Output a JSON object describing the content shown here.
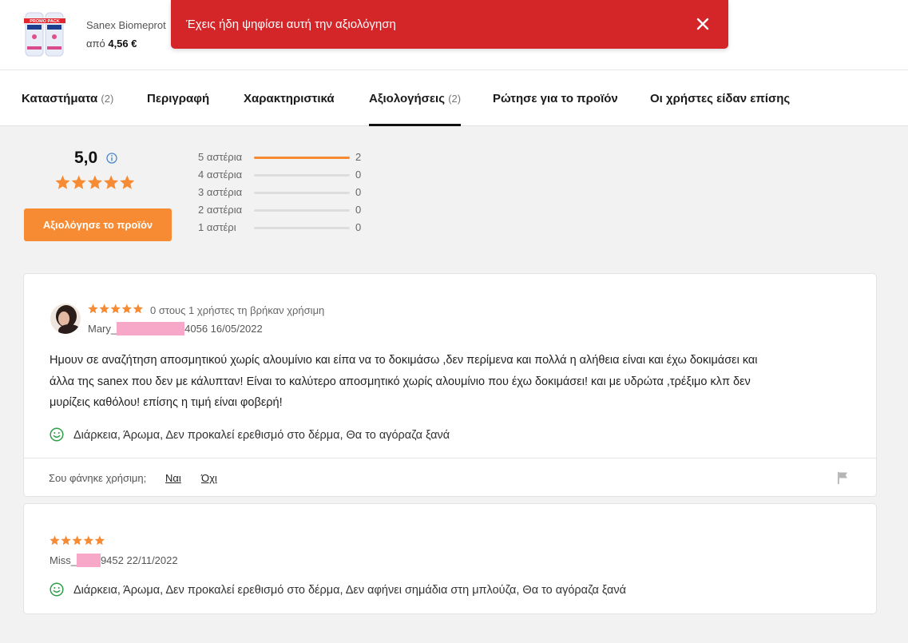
{
  "header": {
    "product_name": "Sanex Biomeprot",
    "price_prefix": "από",
    "price": "4,56 €",
    "thumb_text": "PROMO PACK"
  },
  "toast": {
    "message": "Έχεις ήδη ψηφίσει αυτή την αξιολόγηση"
  },
  "tabs": [
    {
      "label": "Καταστήματα",
      "count": "(2)"
    },
    {
      "label": "Περιγραφή",
      "count": ""
    },
    {
      "label": "Χαρακτηριστικά",
      "count": ""
    },
    {
      "label": "Αξιολογήσεις",
      "count": "(2)"
    },
    {
      "label": "Ρώτησε για το προϊόν",
      "count": ""
    },
    {
      "label": "Οι χρήστες είδαν επίσης",
      "count": ""
    }
  ],
  "summary": {
    "average": "5,0",
    "stars": 5,
    "rate_button": "Αξιολόγησε το προϊόν",
    "distribution": [
      {
        "label": "5 αστέρια",
        "count": "2",
        "fraction": 1.0
      },
      {
        "label": "4 αστέρια",
        "count": "0",
        "fraction": 0
      },
      {
        "label": "3 αστέρια",
        "count": "0",
        "fraction": 0
      },
      {
        "label": "2 αστέρια",
        "count": "0",
        "fraction": 0
      },
      {
        "label": "1 αστέρι",
        "count": "0",
        "fraction": 0
      }
    ]
  },
  "reviews": [
    {
      "stars": 5,
      "helpful": "0 στους 1 χρήστες τη βρήκαν χρήσιμη",
      "user_prefix": "Mary_",
      "user_suffix": "4056",
      "date": "16/05/2022",
      "text": "Ημουν σε αναζήτηση αποσμητικού χωρίς αλουμίνιο και είπα να το δοκιμάσω ,δεν περίμενα και πολλά η αλήθεια είναι και έχω δοκιμάσει και άλλα της sanex που δεν με κάλυπταν! Είναι το καλύτερο αποσμητικό χωρίς αλουμίνιο που έχω δοκιμάσει! και με υδρώτα ,τρέξιμο κλπ δεν μυρίζεις καθόλου! επίσης η τιμή είναι φοβερή!",
      "pros": "Διάρκεια, Άρωμα, Δεν προκαλεί ερεθισμό στο δέρμα, Θα το αγόραζα ξανά",
      "helpful_question": "Σου φάνηκε χρήσιμη;",
      "yes": "Ναι",
      "no": "Όχι"
    },
    {
      "stars": 5,
      "user_prefix": "Miss_",
      "user_suffix": "9452",
      "date": "22/11/2022",
      "pros": "Διάρκεια, Άρωμα, Δεν προκαλεί ερεθισμό στο δέρμα, Δεν αφήνει σημάδια στη μπλούζα, Θα το αγόραζα ξανά"
    }
  ],
  "colors": {
    "accent": "#f68b33",
    "toast": "#d42629",
    "positive": "#2e9e4a",
    "info": "#4a86c8"
  }
}
